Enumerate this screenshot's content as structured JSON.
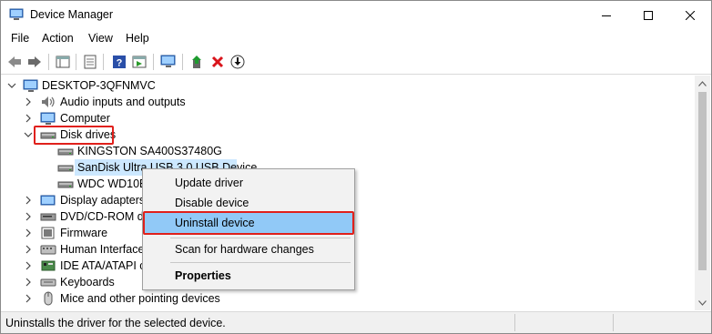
{
  "window": {
    "title": "Device Manager",
    "accent": "#e0201b"
  },
  "menubar": {
    "items": [
      "File",
      "Action",
      "View",
      "Help"
    ]
  },
  "toolbar": {
    "buttons": [
      "back-icon",
      "forward-icon",
      "show-hide-console-tree-icon",
      "properties-icon",
      "help-icon",
      "run-icon",
      "scan-hardware-icon",
      "update-driver-icon",
      "uninstall-icon",
      "download-icon"
    ]
  },
  "tree": {
    "root": "DESKTOP-3QFNMVC",
    "items": [
      {
        "label": "Audio inputs and outputs",
        "icon": "speaker-icon"
      },
      {
        "label": "Computer",
        "icon": "monitor-icon"
      },
      {
        "label": "Disk drives",
        "icon": "disk-drive-icon",
        "expanded": true
      },
      {
        "label": "KINGSTON SA400S37480G",
        "icon": "disk-drive-icon"
      },
      {
        "label": "SanDisk Ultra USB 3.0 USB Device",
        "icon": "disk-drive-icon",
        "selected": true
      },
      {
        "label": "WDC WD10E",
        "icon": "disk-drive-icon"
      },
      {
        "label": "Display adapters",
        "icon": "display-adapter-icon"
      },
      {
        "label": "DVD/CD-ROM dr",
        "icon": "dvd-icon"
      },
      {
        "label": "Firmware",
        "icon": "firmware-icon"
      },
      {
        "label": "Human Interface",
        "icon": "hid-icon"
      },
      {
        "label": "IDE ATA/ATAPI co",
        "icon": "ide-icon"
      },
      {
        "label": "Keyboards",
        "icon": "keyboard-icon"
      },
      {
        "label": "Mice and other pointing devices",
        "icon": "mouse-icon"
      }
    ]
  },
  "context_menu": {
    "items": [
      {
        "label": "Update driver"
      },
      {
        "label": "Disable device"
      },
      {
        "label": "Uninstall device",
        "hover": true
      },
      {
        "label": "Scan for hardware changes"
      },
      {
        "label": "Properties",
        "bold": true
      }
    ]
  },
  "statusbar": {
    "text": "Uninstalls the driver for the selected device."
  }
}
